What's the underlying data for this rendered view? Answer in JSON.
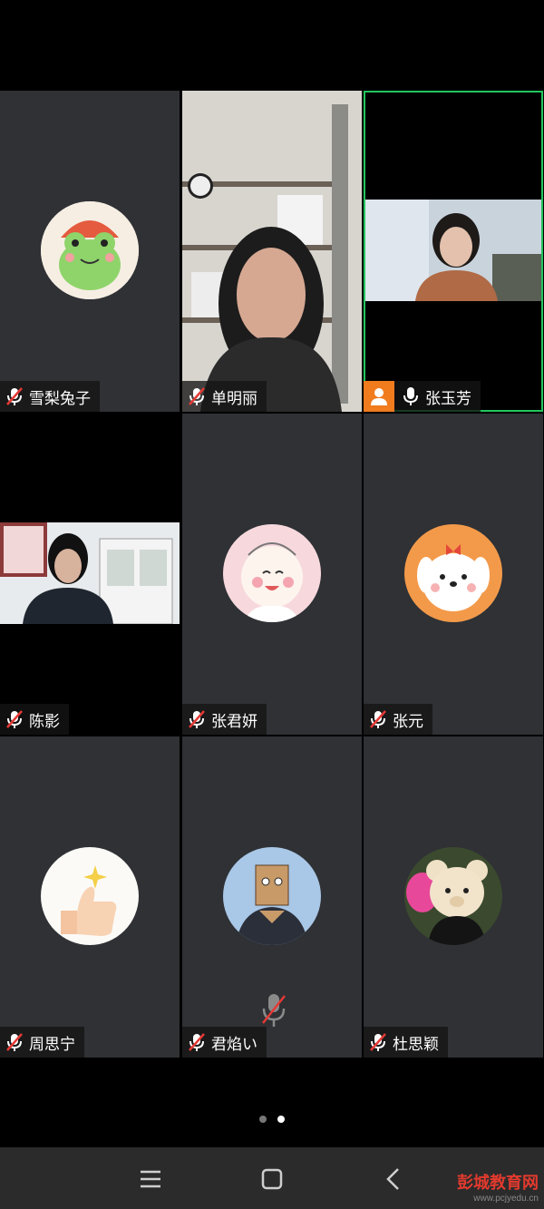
{
  "participants": [
    {
      "name": "雪梨兔子",
      "muted": true
    },
    {
      "name": "单明丽",
      "muted": true
    },
    {
      "name": "张玉芳",
      "muted": false,
      "active": true
    },
    {
      "name": "陈影",
      "muted": true
    },
    {
      "name": "张君妍",
      "muted": true
    },
    {
      "name": "张元",
      "muted": true
    },
    {
      "name": "周思宁",
      "muted": true
    },
    {
      "name": "君焰い",
      "muted": true
    },
    {
      "name": "杜思颖",
      "muted": true
    }
  ],
  "pager": {
    "pages": 2,
    "current": 2
  },
  "watermark": {
    "title": "彭城教育网",
    "url": "www.pcjyedu.cn"
  },
  "colors": {
    "tile": "#2f3135",
    "active_border": "#22c55e",
    "badge": "#f07c1e"
  }
}
